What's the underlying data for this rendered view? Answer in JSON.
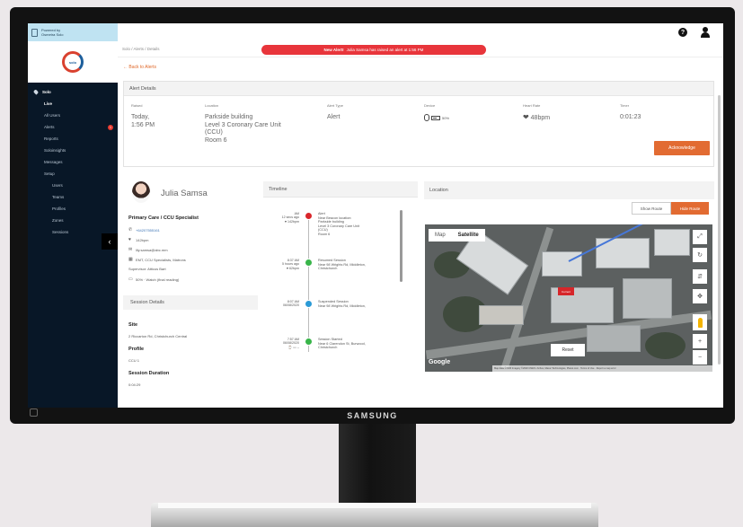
{
  "monitor": {
    "brand": "SAMSUNG"
  },
  "sidebar": {
    "powered_by": [
      "Powered by",
      "Osmetra Solo"
    ],
    "logo_text": "solo",
    "items": [
      {
        "label": "Solo",
        "level": 0
      },
      {
        "label": "Live",
        "level": 1,
        "active": true
      },
      {
        "label": "All Users",
        "level": 1
      },
      {
        "label": "Alerts",
        "level": 1,
        "badge": "1"
      },
      {
        "label": "Reports",
        "level": 1
      },
      {
        "label": "Soloinsights",
        "level": 1
      },
      {
        "label": "Messages",
        "level": 1
      },
      {
        "label": "Setup",
        "level": 1
      },
      {
        "label": "Users",
        "level": 2
      },
      {
        "label": "Teams",
        "level": 2
      },
      {
        "label": "Profiles",
        "level": 2
      },
      {
        "label": "Zones",
        "level": 2
      },
      {
        "label": "Sessions",
        "level": 2
      }
    ],
    "collapse_glyph": "‹"
  },
  "topbar": {
    "help_glyph": "?"
  },
  "breadcrumb": "Solo / Alerts / Details",
  "banner": {
    "strong": "New Alert!",
    "text": "Julia Samsa has raised an alert at 1:56 PM"
  },
  "back_link": "← Back to Alerts",
  "alert_details": {
    "title": "Alert Details",
    "columns": {
      "raised": {
        "label": "Raised",
        "lines": [
          "Today,",
          "1:56 PM"
        ]
      },
      "location": {
        "label": "Location",
        "lines": [
          "Parkside building",
          "Level 3 Coronary Care Unit",
          "(CCU)",
          "Room 6"
        ]
      },
      "alert_type": {
        "label": "Alert Type",
        "lines": [
          "Alert"
        ]
      },
      "device": {
        "label": "Device",
        "value": "50%"
      },
      "heart_rate": {
        "label": "Heart Rate",
        "value": "48bpm"
      },
      "timer": {
        "label": "Timer",
        "value": "0:01:23"
      }
    },
    "acknowledge": "Acknowledge"
  },
  "profile": {
    "name": "Julia Samsa",
    "role": "Primary Care / CCU Specialist",
    "phone": "+64207555161",
    "heart": "142bpm",
    "email": "lily.samsa@abc.mm",
    "team": "EMT, CCU Specialists, Matrons",
    "supervisor": "Supervisor: Atticus Bart",
    "device": "50% · Watch (final reading)"
  },
  "session": {
    "title": "Session Details",
    "site_label": "Site",
    "site_value": "2 Riccarton Rd, Christchurch Central",
    "profile_label": "Profile",
    "profile_value": "CCU 1",
    "duration_label": "Session Duration",
    "duration_value": "0:04:29"
  },
  "timeline": {
    "title": "Timeline",
    "events": [
      {
        "time": [
          "AM",
          "12 secs ago",
          "♥ 142bpm"
        ],
        "text": [
          "Alert",
          "Near Beacon location:",
          "Parkside building",
          "Level 3 Coronary Care Unit",
          "(CCU)",
          "Room 6"
        ],
        "color": "#d9262b"
      },
      {
        "time": [
          "8:37 AM",
          "5 hours ago",
          "♥ 62bpm"
        ],
        "text": [
          "Resumed Session",
          "Near 98 Wrights Rd, Middleton,",
          "Christchurch"
        ],
        "color": "#39b54a"
      },
      {
        "time": [
          "8:07 AM",
          "06/08/2020"
        ],
        "text": [
          "Suspended Session",
          "Near 98 Wrights Rd, Middleton,"
        ],
        "color": "#2b9ad6"
      },
      {
        "time": [
          "7:57 AM",
          "06/08/2020",
          "⌚ ▭ --"
        ],
        "text": [
          "Session Started",
          "Near 6 Clarendon St, Burwood,",
          "Christchurch"
        ],
        "color": "#39b54a"
      }
    ]
  },
  "location": {
    "title": "Location",
    "show_route": "Show Route",
    "hide_route": "Hide Route",
    "map_tab": "Map",
    "satellite_tab": "Satellite",
    "marker": "Current",
    "reset": "Reset",
    "google": "Google",
    "attribution": "Map data ©2020 Imagery ©2020 CNES / Airbus, Maxar Technologies, Planet.com · Terms of Use · Report a map error"
  }
}
